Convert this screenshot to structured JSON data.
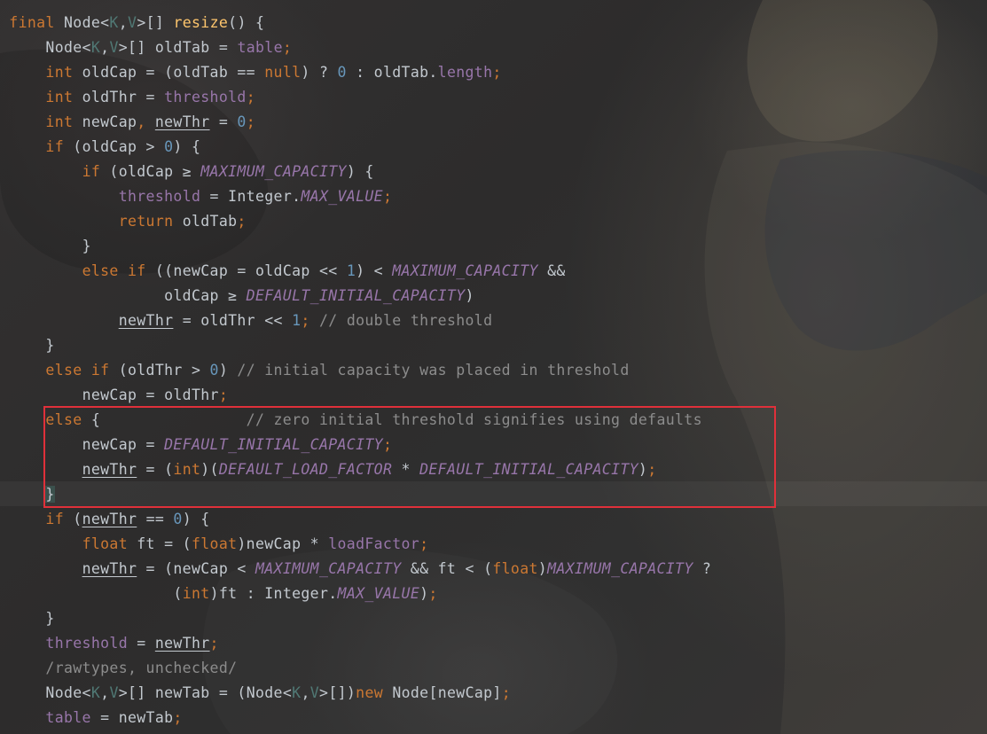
{
  "code_lines": [
    {
      "indent": 0,
      "tokens": [
        {
          "cls": "k",
          "text": "final "
        },
        {
          "cls": "t",
          "text": "Node<"
        },
        {
          "cls": "tp",
          "text": "K"
        },
        {
          "cls": "t",
          "text": ","
        },
        {
          "cls": "tp",
          "text": "V"
        },
        {
          "cls": "t",
          "text": ">[] "
        },
        {
          "cls": "f",
          "text": "resize"
        },
        {
          "cls": "t",
          "text": "() {"
        }
      ]
    },
    {
      "indent": 4,
      "tokens": [
        {
          "cls": "t",
          "text": "Node<"
        },
        {
          "cls": "tp",
          "text": "K"
        },
        {
          "cls": "t",
          "text": ","
        },
        {
          "cls": "tp",
          "text": "V"
        },
        {
          "cls": "t",
          "text": ">[] oldTab = "
        },
        {
          "cls": "fd",
          "text": "table"
        },
        {
          "cls": "k",
          "text": ";"
        }
      ]
    },
    {
      "indent": 4,
      "tokens": [
        {
          "cls": "k",
          "text": "int "
        },
        {
          "cls": "t",
          "text": "oldCap = (oldTab == "
        },
        {
          "cls": "k",
          "text": "null"
        },
        {
          "cls": "t",
          "text": ") ? "
        },
        {
          "cls": "n",
          "text": "0"
        },
        {
          "cls": "t",
          "text": " : oldTab."
        },
        {
          "cls": "fd",
          "text": "length"
        },
        {
          "cls": "k",
          "text": ";"
        }
      ]
    },
    {
      "indent": 4,
      "tokens": [
        {
          "cls": "k",
          "text": "int "
        },
        {
          "cls": "t",
          "text": "oldThr = "
        },
        {
          "cls": "fd",
          "text": "threshold"
        },
        {
          "cls": "k",
          "text": ";"
        }
      ]
    },
    {
      "indent": 4,
      "tokens": [
        {
          "cls": "k",
          "text": "int "
        },
        {
          "cls": "t",
          "text": "newCap"
        },
        {
          "cls": "k",
          "text": ", "
        },
        {
          "cls": "t u",
          "text": "newThr"
        },
        {
          "cls": "t",
          "text": " = "
        },
        {
          "cls": "n",
          "text": "0"
        },
        {
          "cls": "k",
          "text": ";"
        }
      ]
    },
    {
      "indent": 4,
      "tokens": [
        {
          "cls": "k",
          "text": "if "
        },
        {
          "cls": "t",
          "text": "(oldCap > "
        },
        {
          "cls": "n",
          "text": "0"
        },
        {
          "cls": "t",
          "text": ") {"
        }
      ]
    },
    {
      "indent": 8,
      "tokens": [
        {
          "cls": "k",
          "text": "if "
        },
        {
          "cls": "t",
          "text": "(oldCap ≥ "
        },
        {
          "cls": "cn",
          "text": "MAXIMUM_CAPACITY"
        },
        {
          "cls": "t",
          "text": ") {"
        }
      ]
    },
    {
      "indent": 12,
      "tokens": [
        {
          "cls": "fd",
          "text": "threshold"
        },
        {
          "cls": "t",
          "text": " = Integer."
        },
        {
          "cls": "cn",
          "text": "MAX_VALUE"
        },
        {
          "cls": "k",
          "text": ";"
        }
      ]
    },
    {
      "indent": 12,
      "tokens": [
        {
          "cls": "k",
          "text": "return "
        },
        {
          "cls": "t",
          "text": "oldTab"
        },
        {
          "cls": "k",
          "text": ";"
        }
      ]
    },
    {
      "indent": 8,
      "tokens": [
        {
          "cls": "t",
          "text": "}"
        }
      ]
    },
    {
      "indent": 8,
      "tokens": [
        {
          "cls": "k",
          "text": "else if "
        },
        {
          "cls": "t",
          "text": "((newCap = oldCap << "
        },
        {
          "cls": "n",
          "text": "1"
        },
        {
          "cls": "t",
          "text": ") < "
        },
        {
          "cls": "cn",
          "text": "MAXIMUM_CAPACITY"
        },
        {
          "cls": "t",
          "text": " &&"
        }
      ]
    },
    {
      "indent": 17,
      "tokens": [
        {
          "cls": "t",
          "text": "oldCap ≥ "
        },
        {
          "cls": "cn",
          "text": "DEFAULT_INITIAL_CAPACITY"
        },
        {
          "cls": "t",
          "text": ")"
        }
      ]
    },
    {
      "indent": 12,
      "tokens": [
        {
          "cls": "t u",
          "text": "newThr"
        },
        {
          "cls": "t",
          "text": " = oldThr << "
        },
        {
          "cls": "n",
          "text": "1"
        },
        {
          "cls": "k",
          "text": "; "
        },
        {
          "cls": "c",
          "text": "// double threshold"
        }
      ]
    },
    {
      "indent": 4,
      "tokens": [
        {
          "cls": "t",
          "text": "}"
        }
      ]
    },
    {
      "indent": 4,
      "tokens": [
        {
          "cls": "k",
          "text": "else if "
        },
        {
          "cls": "t",
          "text": "(oldThr > "
        },
        {
          "cls": "n",
          "text": "0"
        },
        {
          "cls": "t",
          "text": ") "
        },
        {
          "cls": "c",
          "text": "// initial capacity was placed in threshold"
        }
      ]
    },
    {
      "indent": 8,
      "tokens": [
        {
          "cls": "t",
          "text": "newCap = oldThr"
        },
        {
          "cls": "k",
          "text": ";"
        }
      ]
    },
    {
      "indent": 4,
      "tokens": [
        {
          "cls": "k",
          "text": "else "
        },
        {
          "cls": "t",
          "text": "{                "
        },
        {
          "cls": "c",
          "text": "// zero initial threshold signifies using defaults"
        }
      ]
    },
    {
      "indent": 8,
      "tokens": [
        {
          "cls": "t",
          "text": "newCap = "
        },
        {
          "cls": "cn",
          "text": "DEFAULT_INITIAL_CAPACITY"
        },
        {
          "cls": "k",
          "text": ";"
        }
      ]
    },
    {
      "indent": 8,
      "tokens": [
        {
          "cls": "t u",
          "text": "newThr"
        },
        {
          "cls": "t",
          "text": " = ("
        },
        {
          "cls": "k",
          "text": "int"
        },
        {
          "cls": "t",
          "text": ")("
        },
        {
          "cls": "cn",
          "text": "DEFAULT_LOAD_FACTOR"
        },
        {
          "cls": "t",
          "text": " * "
        },
        {
          "cls": "cn",
          "text": "DEFAULT_INITIAL_CAPACITY"
        },
        {
          "cls": "t",
          "text": ")"
        },
        {
          "cls": "k",
          "text": ";"
        }
      ]
    },
    {
      "indent": 4,
      "tokens": [
        {
          "cls": "t cur",
          "text": "}"
        }
      ]
    },
    {
      "indent": 4,
      "tokens": [
        {
          "cls": "k",
          "text": "if "
        },
        {
          "cls": "t",
          "text": "("
        },
        {
          "cls": "t u",
          "text": "newThr"
        },
        {
          "cls": "t",
          "text": " == "
        },
        {
          "cls": "n",
          "text": "0"
        },
        {
          "cls": "t",
          "text": ") {"
        }
      ]
    },
    {
      "indent": 8,
      "tokens": [
        {
          "cls": "k",
          "text": "float "
        },
        {
          "cls": "t",
          "text": "ft = ("
        },
        {
          "cls": "k",
          "text": "float"
        },
        {
          "cls": "t",
          "text": ")newCap * "
        },
        {
          "cls": "fd",
          "text": "loadFactor"
        },
        {
          "cls": "k",
          "text": ";"
        }
      ]
    },
    {
      "indent": 8,
      "tokens": [
        {
          "cls": "t u",
          "text": "newThr"
        },
        {
          "cls": "t",
          "text": " = (newCap < "
        },
        {
          "cls": "cn",
          "text": "MAXIMUM_CAPACITY"
        },
        {
          "cls": "t",
          "text": " && ft < ("
        },
        {
          "cls": "k",
          "text": "float"
        },
        {
          "cls": "t",
          "text": ")"
        },
        {
          "cls": "cn",
          "text": "MAXIMUM_CAPACITY"
        },
        {
          "cls": "t",
          "text": " ?"
        }
      ]
    },
    {
      "indent": 18,
      "tokens": [
        {
          "cls": "t",
          "text": "("
        },
        {
          "cls": "k",
          "text": "int"
        },
        {
          "cls": "t",
          "text": ")ft : Integer."
        },
        {
          "cls": "cn",
          "text": "MAX_VALUE"
        },
        {
          "cls": "t",
          "text": ")"
        },
        {
          "cls": "k",
          "text": ";"
        }
      ]
    },
    {
      "indent": 4,
      "tokens": [
        {
          "cls": "t",
          "text": "}"
        }
      ]
    },
    {
      "indent": 4,
      "tokens": [
        {
          "cls": "fd",
          "text": "threshold"
        },
        {
          "cls": "t",
          "text": " = "
        },
        {
          "cls": "t u",
          "text": "newThr"
        },
        {
          "cls": "k",
          "text": ";"
        }
      ]
    },
    {
      "indent": 4,
      "tokens": [
        {
          "cls": "c",
          "text": "/rawtypes, unchecked/"
        }
      ]
    },
    {
      "indent": 4,
      "tokens": [
        {
          "cls": "t",
          "text": "Node<"
        },
        {
          "cls": "tp",
          "text": "K"
        },
        {
          "cls": "t",
          "text": ","
        },
        {
          "cls": "tp",
          "text": "V"
        },
        {
          "cls": "t",
          "text": ">[] newTab = (Node<"
        },
        {
          "cls": "tp",
          "text": "K"
        },
        {
          "cls": "t",
          "text": ","
        },
        {
          "cls": "tp",
          "text": "V"
        },
        {
          "cls": "t",
          "text": ">[])"
        },
        {
          "cls": "k",
          "text": "new "
        },
        {
          "cls": "t",
          "text": "Node[newCap]"
        },
        {
          "cls": "k",
          "text": ";"
        }
      ]
    },
    {
      "indent": 4,
      "tokens": [
        {
          "cls": "fd",
          "text": "table"
        },
        {
          "cls": "t",
          "text": " = newTab"
        },
        {
          "cls": "k",
          "text": ";"
        }
      ]
    }
  ],
  "colors": {
    "background": "#2b2b2b",
    "keyword": "#cc7832",
    "method": "#ffc66d",
    "field": "#9876aa",
    "number": "#6897bb",
    "comment": "#8c8c8c",
    "text": "#c3c9cf",
    "selection_box": "#e0303a"
  }
}
